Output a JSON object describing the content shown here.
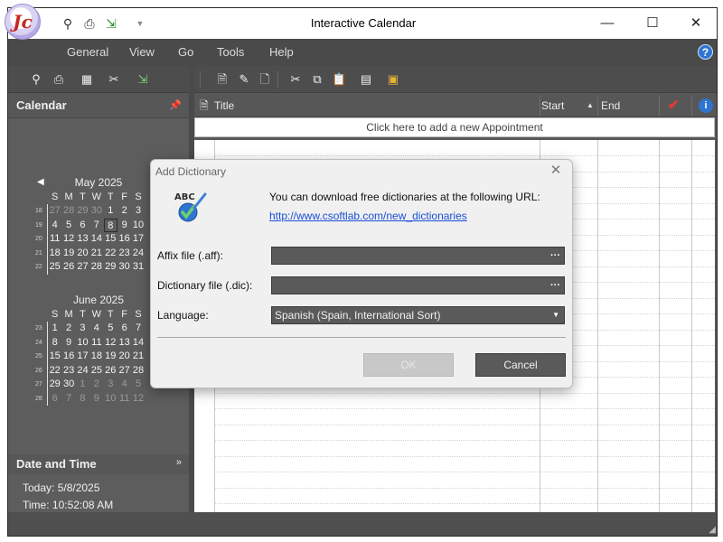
{
  "window": {
    "title": "Interactive Calendar",
    "logo_text": "Jc",
    "quick_access": [
      "search-icon",
      "print-icon",
      "export-icon",
      "dropdown-icon"
    ],
    "controls": {
      "minimize": "—",
      "maximize": "☐",
      "close": "✕"
    }
  },
  "menu": [
    "General",
    "View",
    "Go",
    "Tools",
    "Help"
  ],
  "help_glyph": "?",
  "calendar_panel": {
    "title": "Calendar",
    "months": [
      {
        "title": "May 2025",
        "dow": [
          "S",
          "M",
          "T",
          "W",
          "T",
          "F",
          "S"
        ],
        "weeks": [
          {
            "wk": "18",
            "days": [
              "27",
              "28",
              "29",
              "30",
              "1",
              "2",
              "3"
            ],
            "other": [
              0,
              1,
              2,
              3
            ]
          },
          {
            "wk": "19",
            "days": [
              "4",
              "5",
              "6",
              "7",
              "8",
              "9",
              "10"
            ],
            "other": [],
            "today": 4
          },
          {
            "wk": "20",
            "days": [
              "11",
              "12",
              "13",
              "14",
              "15",
              "16",
              "17"
            ],
            "other": []
          },
          {
            "wk": "21",
            "days": [
              "18",
              "19",
              "20",
              "21",
              "22",
              "23",
              "24"
            ],
            "other": []
          },
          {
            "wk": "22",
            "days": [
              "25",
              "26",
              "27",
              "28",
              "29",
              "30",
              "31"
            ],
            "other": []
          }
        ]
      },
      {
        "title": "June 2025",
        "dow": [
          "S",
          "M",
          "T",
          "W",
          "T",
          "F",
          "S"
        ],
        "weeks": [
          {
            "wk": "23",
            "days": [
              "1",
              "2",
              "3",
              "4",
              "5",
              "6",
              "7"
            ],
            "other": []
          },
          {
            "wk": "24",
            "days": [
              "8",
              "9",
              "10",
              "11",
              "12",
              "13",
              "14"
            ],
            "other": []
          },
          {
            "wk": "25",
            "days": [
              "15",
              "16",
              "17",
              "18",
              "19",
              "20",
              "21"
            ],
            "other": []
          },
          {
            "wk": "26",
            "days": [
              "22",
              "23",
              "24",
              "25",
              "26",
              "27",
              "28"
            ],
            "other": []
          },
          {
            "wk": "27",
            "days": [
              "29",
              "30",
              "1",
              "2",
              "3",
              "4",
              "5"
            ],
            "other": [
              2,
              3,
              4,
              5,
              6
            ]
          },
          {
            "wk": "28",
            "days": [
              "6",
              "7",
              "8",
              "9",
              "10",
              "11",
              "12"
            ],
            "other": [
              0,
              1,
              2,
              3,
              4,
              5,
              6
            ]
          }
        ]
      }
    ]
  },
  "date_time": {
    "title": "Date and Time",
    "today": "Today: 5/8/2025",
    "time": "Time: 10:52:08 AM"
  },
  "grid": {
    "columns": {
      "title": "Title",
      "start": "Start",
      "end": "End"
    },
    "add_prompt": "Click here to add a new Appointment"
  },
  "dialog": {
    "title": "Add Dictionary",
    "message": "You can download free dictionaries at the following URL:",
    "link": "http://www.csoftlab.com/new_dictionaries",
    "affix_label": "Affix file (.aff):",
    "affix_value": "",
    "dic_label": "Dictionary file (.dic):",
    "dic_value": "",
    "language_label": "Language:",
    "language_value": "Spanish (Spain, International Sort)",
    "browse": "···",
    "ok": "OK",
    "cancel": "Cancel",
    "icon_text": "ABC"
  }
}
